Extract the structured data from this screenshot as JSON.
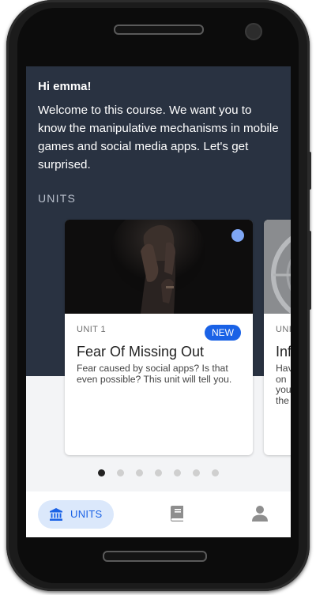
{
  "greeting": "Hi emma!",
  "welcome": "Welcome to this course. We want you to know the manipulative mechanisms in mobile games and social media apps. Let's get surprised.",
  "units_heading": "UNITS",
  "cards": [
    {
      "unit_label": "UNIT 1",
      "badge": "NEW",
      "title": "Fear Of Missing Out",
      "description": "Fear caused by social apps? Is that even possible? This unit will tell you."
    },
    {
      "unit_label": "UNI",
      "title": "Inf",
      "description": "Hav on you the"
    }
  ],
  "pager": {
    "count": 7,
    "active_index": 0
  },
  "bottom_nav": {
    "units_label": "UNITS"
  },
  "colors": {
    "hero_bg": "#293241",
    "accent": "#1a62e6",
    "nav_active_bg": "#dbe8fb"
  }
}
